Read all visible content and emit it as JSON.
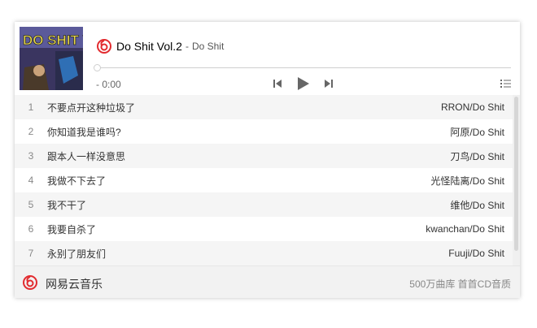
{
  "player": {
    "song_title": "Do Shit Vol.2",
    "separator": "-",
    "song_artist": "Do Shit",
    "time": "- 0:00",
    "progress": 0,
    "cover_text": "DO SHIT VOL"
  },
  "playlist": [
    {
      "num": "1",
      "name": "不要点开这种垃圾了",
      "artist": "RRON/Do Shit"
    },
    {
      "num": "2",
      "name": "你知道我是谁吗?",
      "artist": "阿原/Do Shit"
    },
    {
      "num": "3",
      "name": "跟本人一样没意思",
      "artist": "刀鸟/Do Shit"
    },
    {
      "num": "4",
      "name": "我做不下去了",
      "artist": "光怪陆离/Do Shit"
    },
    {
      "num": "5",
      "name": "我不干了",
      "artist": "维他/Do Shit"
    },
    {
      "num": "6",
      "name": "我要自杀了",
      "artist": "kwanchan/Do Shit"
    },
    {
      "num": "7",
      "name": "永别了朋友们",
      "artist": "Fuuji/Do Shit"
    }
  ],
  "footer": {
    "brand": "网易云音乐",
    "tagline": "500万曲库 首首CD音质"
  },
  "colors": {
    "brand_red": "#e22b2f",
    "control_gray": "#666666"
  },
  "icons": [
    "netease-logo-icon",
    "prev-icon",
    "play-icon",
    "next-icon",
    "playlist-icon"
  ]
}
